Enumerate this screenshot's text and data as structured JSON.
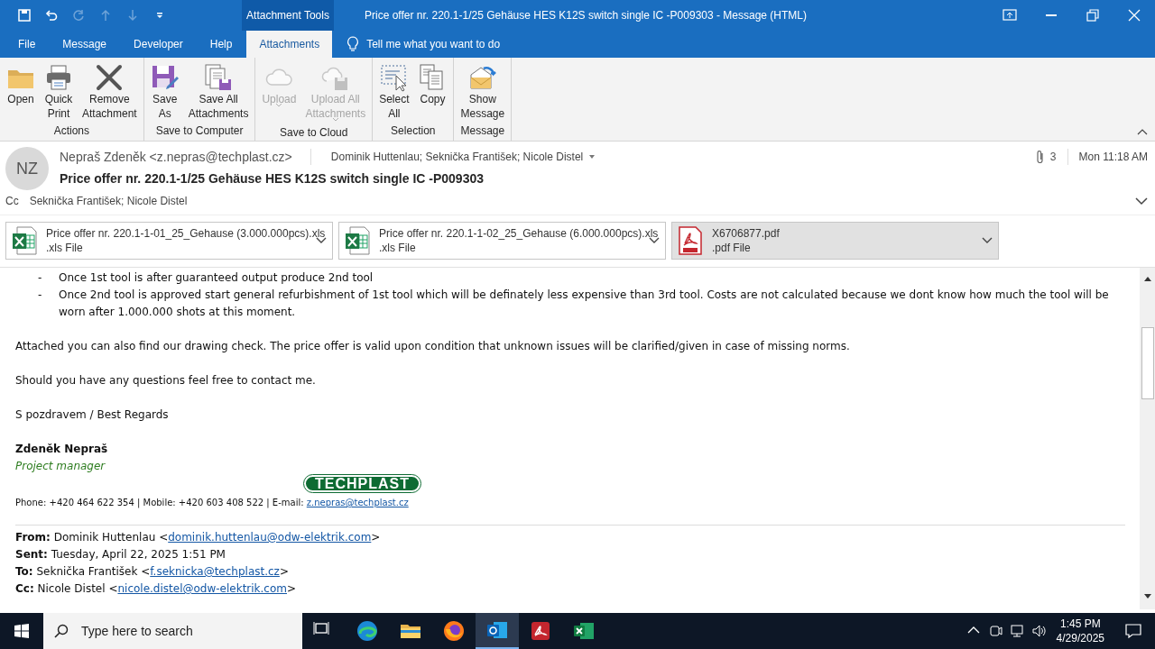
{
  "quick_access": [
    {
      "kind": "save",
      "disabled": false
    },
    {
      "kind": "undo",
      "disabled": false
    },
    {
      "kind": "redo",
      "disabled": true
    },
    {
      "kind": "up",
      "disabled": true
    },
    {
      "kind": "down",
      "disabled": true
    },
    {
      "kind": "customize",
      "disabled": false
    }
  ],
  "contextual_tab": "Attachment Tools",
  "window": {
    "title": "Price offer nr. 220.1-1/25 Gehäuse HES K12S switch single IC -P009303  -  Message (HTML)"
  },
  "menu_tabs": [
    {
      "label": "File",
      "selected": false
    },
    {
      "label": "Message",
      "selected": false
    },
    {
      "label": "Developer",
      "selected": false
    },
    {
      "label": "Help",
      "selected": false
    },
    {
      "label": "Attachments",
      "selected": true
    }
  ],
  "tell_me": {
    "placeholder": "Tell me what you want to do"
  },
  "ribbon": [
    {
      "label": "Actions",
      "buttons": [
        {
          "kind": "open",
          "label": "Open",
          "disabled": false,
          "dropdown": false
        },
        {
          "kind": "print",
          "label": "Quick Print",
          "disabled": false,
          "dropdown": false
        },
        {
          "kind": "remove",
          "label": "Remove Attachment",
          "disabled": false,
          "dropdown": false
        }
      ]
    },
    {
      "label": "Save to Computer",
      "buttons": [
        {
          "kind": "saveas",
          "label": "Save As",
          "disabled": false,
          "dropdown": false
        },
        {
          "kind": "saveall",
          "label": "Save All Attachments",
          "disabled": false,
          "dropdown": false
        }
      ]
    },
    {
      "label": "Save to Cloud",
      "buttons": [
        {
          "kind": "cloud",
          "label": "Upload",
          "disabled": true,
          "dropdown": true
        },
        {
          "kind": "cloudsave",
          "label": "Upload All Attachments",
          "disabled": true,
          "dropdown": true
        }
      ]
    },
    {
      "label": "Selection",
      "buttons": [
        {
          "kind": "selectall",
          "label": "Select All",
          "disabled": false,
          "dropdown": false
        },
        {
          "kind": "copy",
          "label": "Copy",
          "disabled": false,
          "dropdown": false
        }
      ]
    },
    {
      "label": "Message",
      "buttons": [
        {
          "kind": "showmsg",
          "label": "Show Message",
          "disabled": false,
          "dropdown": false
        }
      ]
    }
  ],
  "header": {
    "initials": "NZ",
    "sender": "Nepraš Zdeněk <z.nepras@techplast.cz>",
    "recipients": "Dominik Huttenlau; Seknička František; Nicole Distel",
    "attachment_count": "3",
    "time": "Mon 11:18 AM",
    "subject": "Price offer nr. 220.1-1/25 Gehäuse HES K12S switch single IC -P009303",
    "cc_label": "Cc",
    "cc": "Seknička František; Nicole Distel"
  },
  "attachments": [
    {
      "kind": "xls",
      "name": "Price offer nr. 220.1-1-01_25_Gehause (3.000.000pcs).xls",
      "type": ".xls File",
      "selected": false
    },
    {
      "kind": "xls",
      "name": "Price offer nr. 220.1-1-02_25_Gehause (6.000.000pcs).xls",
      "type": ".xls File",
      "selected": false
    },
    {
      "kind": "pdf",
      "name": "X6706877.pdf",
      "type": ".pdf File",
      "selected": true
    }
  ],
  "body": {
    "bullets": [
      {
        "marker": "-",
        "text": "Once 1st tool is after guaranteed output produce 2nd tool"
      },
      {
        "marker": "-",
        "text": "Once 2nd tool is approved start general refurbishment of 1st tool which will be definately less expensive than 3rd tool. Costs are not calculated because we dont know how much the tool will be worn after 1.000.000 shots at this moment."
      }
    ],
    "paragraphs": [
      "Attached you can also find our drawing check. The price offer is valid upon condition that unknown issues will be clarified/given in case of missing norms.",
      "Should you have any questions feel free to contact me.",
      "S pozdravem / Best Regards"
    ],
    "signature": {
      "name": "Zdeněk Nepraš",
      "role": "Project manager",
      "logo": "TECHPLAST",
      "contact": "Phone: +420 464 622 354 | Mobile: +420 603 408 522 | E-mail: ",
      "email": "z.nepras@techplast.cz"
    },
    "forwarded": [
      {
        "label": "From:",
        "before": "Dominik Huttenlau <",
        "email": "dominik.huttenlau@odw-elektrik.com",
        "after": ">"
      },
      {
        "label": "Sent:",
        "before": "Tuesday, April 22, 2025  1:51 PM"
      },
      {
        "label": "To:",
        "before": "Seknička František <",
        "email": "f.seknicka@techplast.cz",
        "after": ">"
      },
      {
        "label": "Cc:",
        "before": "Nicole Distel <",
        "email": "nicole.distel@odw-elektrik.com",
        "after": ">"
      }
    ]
  },
  "taskbar": {
    "search": {
      "placeholder": "Type here to search"
    },
    "apps": [
      {
        "kind": "taskview",
        "active": false
      },
      {
        "kind": "edge",
        "active": false
      },
      {
        "kind": "explorer",
        "active": false
      },
      {
        "kind": "firefox",
        "active": false
      },
      {
        "kind": "outlook",
        "active": true
      },
      {
        "kind": "acrobat",
        "active": false
      },
      {
        "kind": "excel",
        "active": false
      }
    ],
    "time": "1:45 PM",
    "date": "4/29/2025"
  }
}
